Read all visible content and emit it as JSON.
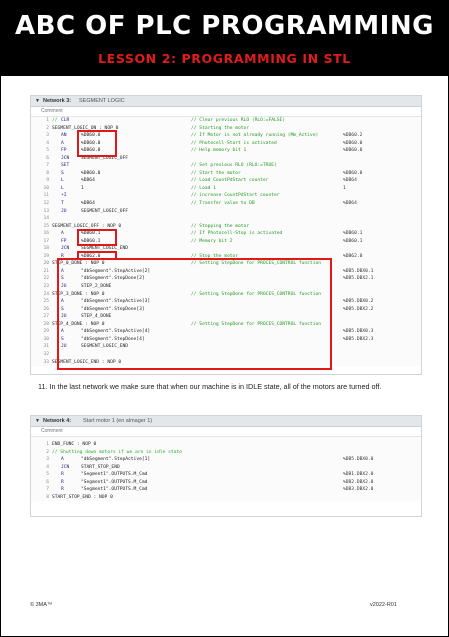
{
  "header": {
    "title": "ABC OF PLC PROGRAMMING",
    "subtitle": "LESSON 2: PROGRAMMING IN STL"
  },
  "network3": {
    "label": "Network 3:",
    "title": "SEGMENT LOGIC",
    "comment": "Comment",
    "lines": [
      {
        "n": "1",
        "stmt": "//",
        "op": "CLR",
        "opd": "",
        "cmt": "// Clear previous RLO (RLO:=FALSE)",
        "addr": ""
      },
      {
        "n": "2",
        "stmt": "SEGMENT_LOGIC_ON : NOP 0",
        "op": "",
        "opd": "",
        "cmt": "// Starting the motor",
        "addr": ""
      },
      {
        "n": "3",
        "stmt": "",
        "op": "AN",
        "opd": "%DB60.0",
        "cmt": "// If Motor is not already running (Mm_Active)",
        "addr": "%DB60.2"
      },
      {
        "n": "4",
        "stmt": "",
        "op": "A",
        "opd": "%DB60.0",
        "cmt": "// Photocell-Start is activated",
        "addr": "%DB60.0"
      },
      {
        "n": "5",
        "stmt": "",
        "op": "FP",
        "opd": "%DB60.0",
        "cmt": "// Help memory bit 1",
        "addr": "%DB60.0"
      },
      {
        "n": "6",
        "stmt": "",
        "op": "JCN",
        "opd": "SEGMENT_LOGIC_OFF",
        "cmt": "",
        "addr": ""
      },
      {
        "n": "7",
        "stmt": "",
        "op": "SET",
        "opd": "",
        "cmt": "// Set previous RLO (RLO:=TRUE)",
        "addr": ""
      },
      {
        "n": "8",
        "stmt": "",
        "op": "S",
        "opd": "%DB60.0",
        "cmt": "// Start the motor",
        "addr": "%DB60.0"
      },
      {
        "n": "9",
        "stmt": "",
        "op": "L",
        "opd": "%DB64",
        "cmt": "// Load CountPdStart counter",
        "addr": "%DB64"
      },
      {
        "n": "10",
        "stmt": "",
        "op": "L",
        "opd": "1",
        "cmt": "// Load 1",
        "addr": "1"
      },
      {
        "n": "11",
        "stmt": "",
        "op": "+I",
        "opd": "",
        "cmt": "// increase CountPdStart counter",
        "addr": ""
      },
      {
        "n": "12",
        "stmt": "",
        "op": "T",
        "opd": "%DB64",
        "cmt": "// Transfer value to DB",
        "addr": "%DB64"
      },
      {
        "n": "13",
        "stmt": "",
        "op": "JU",
        "opd": "SEGMENT_LOGIC_OFF",
        "cmt": "",
        "addr": ""
      },
      {
        "n": "14",
        "stmt": "",
        "op": "",
        "opd": "",
        "cmt": "",
        "addr": ""
      },
      {
        "n": "15",
        "stmt": "SEGMENT_LOGIC_OFF : NOP 0",
        "op": "",
        "opd": "",
        "cmt": "// Stopping the motor",
        "addr": ""
      },
      {
        "n": "16",
        "stmt": "",
        "op": "A",
        "opd": "%DB60.1",
        "cmt": "// If Photocell-Stop is activated",
        "addr": "%DB60.1"
      },
      {
        "n": "17",
        "stmt": "",
        "op": "FP",
        "opd": "%DB60.1",
        "cmt": "// Memory bit 2",
        "addr": "%DB60.1"
      },
      {
        "n": "18",
        "stmt": "",
        "op": "JCN",
        "opd": "SEGMENT_LOGIC_END",
        "cmt": "",
        "addr": ""
      },
      {
        "n": "19",
        "stmt": "",
        "op": "R",
        "opd": "%DB62.0",
        "cmt": "// Stop the motor",
        "addr": "%DB62.0"
      },
      {
        "n": "20",
        "stmt": "STEP_0_DONE : NOP 0",
        "op": "",
        "opd": "",
        "cmt": "// Setting StepDone for PROCES_CONTROL function",
        "addr": ""
      },
      {
        "n": "21",
        "stmt": "",
        "op": "A",
        "opd": "\"dbSegment\".StepActive[2]",
        "cmt": "",
        "addr": "%DB5.DBX0.1"
      },
      {
        "n": "22",
        "stmt": "",
        "op": "S",
        "opd": "\"dbSegment\".StepDone[2]",
        "cmt": "",
        "addr": "%DB5.DBX2.1"
      },
      {
        "n": "23",
        "stmt": "",
        "op": "JU",
        "opd": "STEP_2_DONE",
        "cmt": "",
        "addr": ""
      },
      {
        "n": "24",
        "stmt": "STEP_3_DONE : NOP 0",
        "op": "",
        "opd": "",
        "cmt": "// Setting StepDone for PROCES_CONTROL function",
        "addr": ""
      },
      {
        "n": "25",
        "stmt": "",
        "op": "A",
        "opd": "\"dbSegment\".StepActive[3]",
        "cmt": "",
        "addr": "%DB5.DBX0.2"
      },
      {
        "n": "26",
        "stmt": "",
        "op": "S",
        "opd": "\"dbSegment\".StepDone[3]",
        "cmt": "",
        "addr": "%DB5.DBX2.2"
      },
      {
        "n": "27",
        "stmt": "",
        "op": "JU",
        "opd": "STEP_4_DONE",
        "cmt": "",
        "addr": ""
      },
      {
        "n": "28",
        "stmt": "STEP_4_DONE : NOP 0",
        "op": "",
        "opd": "",
        "cmt": "// Setting StepDone for PROCES_CONTROL function",
        "addr": ""
      },
      {
        "n": "29",
        "stmt": "",
        "op": "A",
        "opd": "\"dbSegment\".StepActive[4]",
        "cmt": "",
        "addr": "%DB5.DBX0.3"
      },
      {
        "n": "30",
        "stmt": "",
        "op": "S",
        "opd": "\"dbSegment\".StepDone[4]",
        "cmt": "",
        "addr": "%DB5.DBX2.3"
      },
      {
        "n": "31",
        "stmt": "",
        "op": "JU",
        "opd": "SEGMENT_LOGIC_END",
        "cmt": "",
        "addr": ""
      },
      {
        "n": "32",
        "stmt": "",
        "op": "",
        "opd": "",
        "cmt": "",
        "addr": ""
      },
      {
        "n": "33",
        "stmt": "SEGMENT_LOGIC_END : NOP 0",
        "op": "",
        "opd": "",
        "cmt": "",
        "addr": ""
      }
    ]
  },
  "note": "11. In the last network we make sure that when our machine is in IDLE state, all of the motors are turned off.",
  "network4": {
    "label": "Network 4:",
    "title": "Start motor 1 (en almager 1)",
    "comment": "Comment",
    "lines": [
      {
        "n": "1",
        "stmt": "END_FUNC : NOP 0",
        "op": "",
        "opd": "",
        "cmt": "",
        "addr": ""
      },
      {
        "n": "2",
        "stmt": "// Shutting down motors if we are in idle state",
        "op": "",
        "opd": "",
        "cmt": "",
        "addr": ""
      },
      {
        "n": "3",
        "stmt": "",
        "op": "A",
        "opd": "\"dbSegment\".StepActive[1]",
        "cmt": "",
        "addr": "%DB5.DBX0.0"
      },
      {
        "n": "4",
        "stmt": "",
        "op": "JCN",
        "opd": "START_STOP_END",
        "cmt": "",
        "addr": ""
      },
      {
        "n": "5",
        "stmt": "",
        "op": "R",
        "opd": "\"Segment1\".OUTPUTS.M_Cmd",
        "cmt": "",
        "addr": "%DB1.DBX2.0"
      },
      {
        "n": "6",
        "stmt": "",
        "op": "R",
        "opd": "\"Segment1\".OUTPUTS.M_Cmd",
        "cmt": "",
        "addr": "%DB2.DBX2.0"
      },
      {
        "n": "7",
        "stmt": "",
        "op": "R",
        "opd": "\"Segment1\".OUTPUTS.M_Cmd",
        "cmt": "",
        "addr": "%DB3.DBX2.0"
      },
      {
        "n": "8",
        "stmt": "START_STOP_END : NOP 0",
        "op": "",
        "opd": "",
        "cmt": "",
        "addr": ""
      }
    ]
  },
  "footer": {
    "left": "© 3MA™",
    "right": "v2022-R01"
  }
}
